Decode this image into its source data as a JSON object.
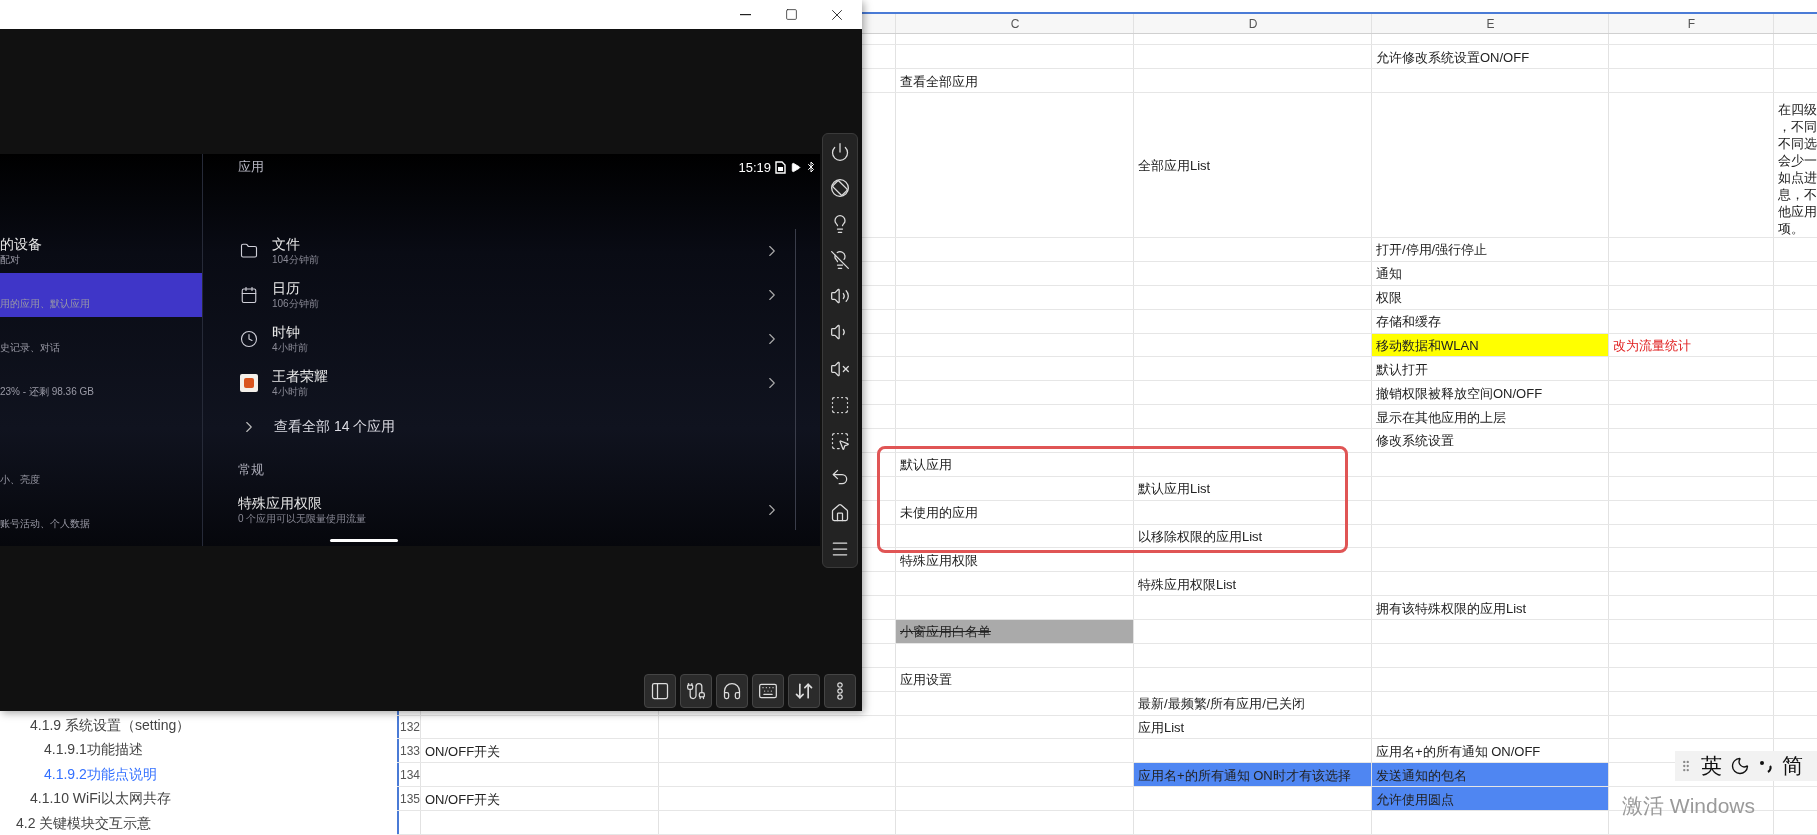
{
  "emulator": {
    "screen": {
      "time": "15:19",
      "section_title": "应用",
      "nav_items": [
        {
          "title": "的设备",
          "subtitle": "配对",
          "selected": false
        },
        {
          "subtitle": "用的应用、默认应用",
          "selected": true
        },
        {
          "subtitle": "史记录、对话",
          "selected": false
        },
        {
          "subtitle": "23% - 还剩 98.36 GB",
          "selected": false
        },
        {
          "subtitle": "小、亮度",
          "selected": false
        },
        {
          "subtitle": "账号活动、个人数据",
          "selected": false
        }
      ],
      "recent_apps": [
        {
          "kind": "folder",
          "name": "文件",
          "time": "104分钟前"
        },
        {
          "kind": "calendar",
          "name": "日历",
          "time": "106分钟前"
        },
        {
          "kind": "clock",
          "name": "时钟",
          "time": "4小时前"
        },
        {
          "kind": "game",
          "name": "王者荣耀",
          "time": "4小时前"
        }
      ],
      "see_all": "查看全部 14 个应用",
      "general_title": "常规",
      "special_access": {
        "title": "特殊应用权限",
        "subtitle": "0 个应用可以无限量使用流量"
      }
    }
  },
  "outline": [
    {
      "children": [
        {
          "text": "4.1.9 系统设置（setting）",
          "selected": false,
          "children": [
            {
              "text": "4.1.9.1功能描述",
              "selected": false
            },
            {
              "text": "4.1.9.2功能点说明",
              "selected": true
            }
          ]
        },
        {
          "text": "4.1.10 WiFi以太网共存",
          "selected": false
        }
      ]
    },
    {
      "text": "4.2 关键模块交互示意",
      "selected": false
    }
  ],
  "sheet": {
    "column_headers": [
      "C",
      "D",
      "E",
      "F"
    ],
    "rows": [
      {
        "kind": "partial"
      },
      {
        "kind": "normal",
        "e": {
          "text": "允许修改系统设置ON/OFF"
        }
      },
      {
        "kind": "normal",
        "c": {
          "text": "查看全部应用"
        }
      },
      {
        "kind": "tall",
        "d": {
          "text": "全部应用List"
        },
        "g": {
          "lines": [
            "在四级",
            "，不同",
            "不同选",
            "会少一",
            "如点进",
            "息，不",
            "他应用",
            "项。"
          ]
        }
      },
      {
        "kind": "normal",
        "e": {
          "text": "打开/停用/强行停止"
        }
      },
      {
        "kind": "normal",
        "e": {
          "text": "通知"
        }
      },
      {
        "kind": "normal",
        "e": {
          "text": "权限"
        }
      },
      {
        "kind": "normal",
        "e": {
          "text": "存储和缓存"
        }
      },
      {
        "kind": "normal",
        "e": {
          "text": "移动数据和WLAN",
          "kind": "filled",
          "color": "#ffff00"
        },
        "f": {
          "text": "改为流量统计",
          "kind": "remark"
        }
      },
      {
        "kind": "normal",
        "e": {
          "text": "默认打开"
        }
      },
      {
        "kind": "normal",
        "e": {
          "text": "撤销权限被释放空间ON/OFF"
        }
      },
      {
        "kind": "normal",
        "e": {
          "text": "显示在其他应用的上层"
        }
      },
      {
        "kind": "normal",
        "e": {
          "text": "修改系统设置"
        }
      },
      {
        "kind": "normal",
        "c": {
          "text": "默认应用"
        }
      },
      {
        "kind": "normal",
        "d": {
          "text": "默认应用List"
        }
      },
      {
        "kind": "normal",
        "c": {
          "text": "未使用的应用"
        }
      },
      {
        "kind": "normal",
        "d": {
          "text": "以移除权限的应用List"
        }
      },
      {
        "kind": "normal",
        "c": {
          "text": "特殊应用权限"
        }
      },
      {
        "kind": "normal",
        "d": {
          "text": "特殊应用权限List"
        }
      },
      {
        "kind": "normal",
        "e": {
          "text": "拥有该特殊权限的应用List"
        }
      },
      {
        "kind": "normal",
        "c": {
          "text": "小窗应用白名单",
          "kind": "filled",
          "color": "#aaaaaa",
          "struck": true
        }
      },
      {
        "kind": "normal"
      },
      {
        "kind": "normal",
        "c": {
          "text": "应用设置"
        }
      },
      {
        "kind": "normal",
        "d": {
          "text": "最新/最频繁/所有应用/已关闭"
        }
      },
      {
        "kind": "normal",
        "number": "132",
        "d": {
          "text": "应用List"
        }
      },
      {
        "kind": "normal",
        "number": "133",
        "a": {
          "text": "ON/OFF开关"
        },
        "e": {
          "text": "应用名+的所有通知 ON/OFF"
        }
      },
      {
        "kind": "normal",
        "number": "134",
        "d": {
          "text": "应用名+的所有通知 ON时才有该选择",
          "kind": "filled",
          "color": "#4f86f2"
        },
        "e": {
          "text": "发送通知的包名",
          "kind": "filled",
          "color": "#4f86f2"
        }
      },
      {
        "kind": "normal",
        "number": "135",
        "a": {
          "text": "ON/OFF开关"
        },
        "e": {
          "text": "允许使用圆点",
          "kind": "filled",
          "color": "#4f86f2"
        }
      },
      {
        "kind": "normal"
      }
    ]
  },
  "ime": {
    "language": "英",
    "script": "简"
  },
  "activation_notice": "激活 Windows"
}
